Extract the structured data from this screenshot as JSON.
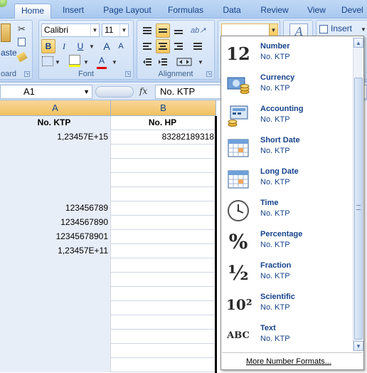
{
  "tabs": [
    {
      "label": "Home",
      "active": true
    },
    {
      "label": "Insert"
    },
    {
      "label": "Page Layout"
    },
    {
      "label": "Formulas"
    },
    {
      "label": "Data"
    },
    {
      "label": "Review"
    },
    {
      "label": "View"
    },
    {
      "label": "Devel"
    }
  ],
  "clipboard": {
    "paste_label": "aste",
    "group_label": "oard"
  },
  "font": {
    "name": "Calibri",
    "size": "11",
    "bold": "B",
    "italic": "I",
    "underline": "U",
    "grow": "A",
    "shrink": "A",
    "color_a": "A",
    "group_label": "Font"
  },
  "alignment": {
    "group_label": "Alignment"
  },
  "number": {
    "format_value": ""
  },
  "cells": {
    "insert_label": "Insert"
  },
  "formula_bar": {
    "name_box": "A1",
    "fx": "fx",
    "content": "No. KTP"
  },
  "columns": [
    "A",
    "B"
  ],
  "rows": [
    {
      "a": "No. KTP",
      "b": "No. HP",
      "header": true
    },
    {
      "a": "1,23457E+15",
      "b": "83282189318"
    },
    {
      "a": "",
      "b": ""
    },
    {
      "a": "",
      "b": ""
    },
    {
      "a": "",
      "b": ""
    },
    {
      "a": "",
      "b": ""
    },
    {
      "a": "123456789",
      "b": ""
    },
    {
      "a": "1234567890",
      "b": ""
    },
    {
      "a": "12345678901",
      "b": ""
    },
    {
      "a": "1,23457E+11",
      "b": ""
    },
    {
      "a": "",
      "b": ""
    },
    {
      "a": "",
      "b": ""
    },
    {
      "a": "",
      "b": ""
    },
    {
      "a": "",
      "b": ""
    },
    {
      "a": "",
      "b": ""
    },
    {
      "a": "",
      "b": ""
    },
    {
      "a": "",
      "b": ""
    },
    {
      "a": "",
      "b": ""
    }
  ],
  "format_menu": {
    "items": [
      {
        "name": "Number",
        "value": "No. KTP",
        "icon": "number-12-icon",
        "glyph": "12"
      },
      {
        "name": "Currency",
        "value": "No. KTP",
        "icon": "currency-icon"
      },
      {
        "name": "Accounting",
        "value": "No. KTP",
        "icon": "accounting-icon"
      },
      {
        "name": "Short Date",
        "value": "No. KTP",
        "icon": "calendar-icon"
      },
      {
        "name": "Long Date",
        "value": "No. KTP",
        "icon": "calendar-icon"
      },
      {
        "name": "Time",
        "value": "No. KTP",
        "icon": "clock-icon"
      },
      {
        "name": "Percentage",
        "value": "No. KTP",
        "icon": "percent-icon",
        "glyph": "%"
      },
      {
        "name": "Fraction",
        "value": "No. KTP",
        "icon": "fraction-icon",
        "glyph": "½"
      },
      {
        "name": "Scientific",
        "value": "No. KTP",
        "icon": "scientific-icon",
        "glyph": "10²"
      },
      {
        "name": "Text",
        "value": "No. KTP",
        "icon": "text-abc-icon",
        "glyph": "ABC"
      }
    ],
    "more_label": "More Number Formats..."
  },
  "colors": {
    "accent": "#15428b",
    "pressed": "#f9c65a",
    "header": "#f1c15f"
  }
}
